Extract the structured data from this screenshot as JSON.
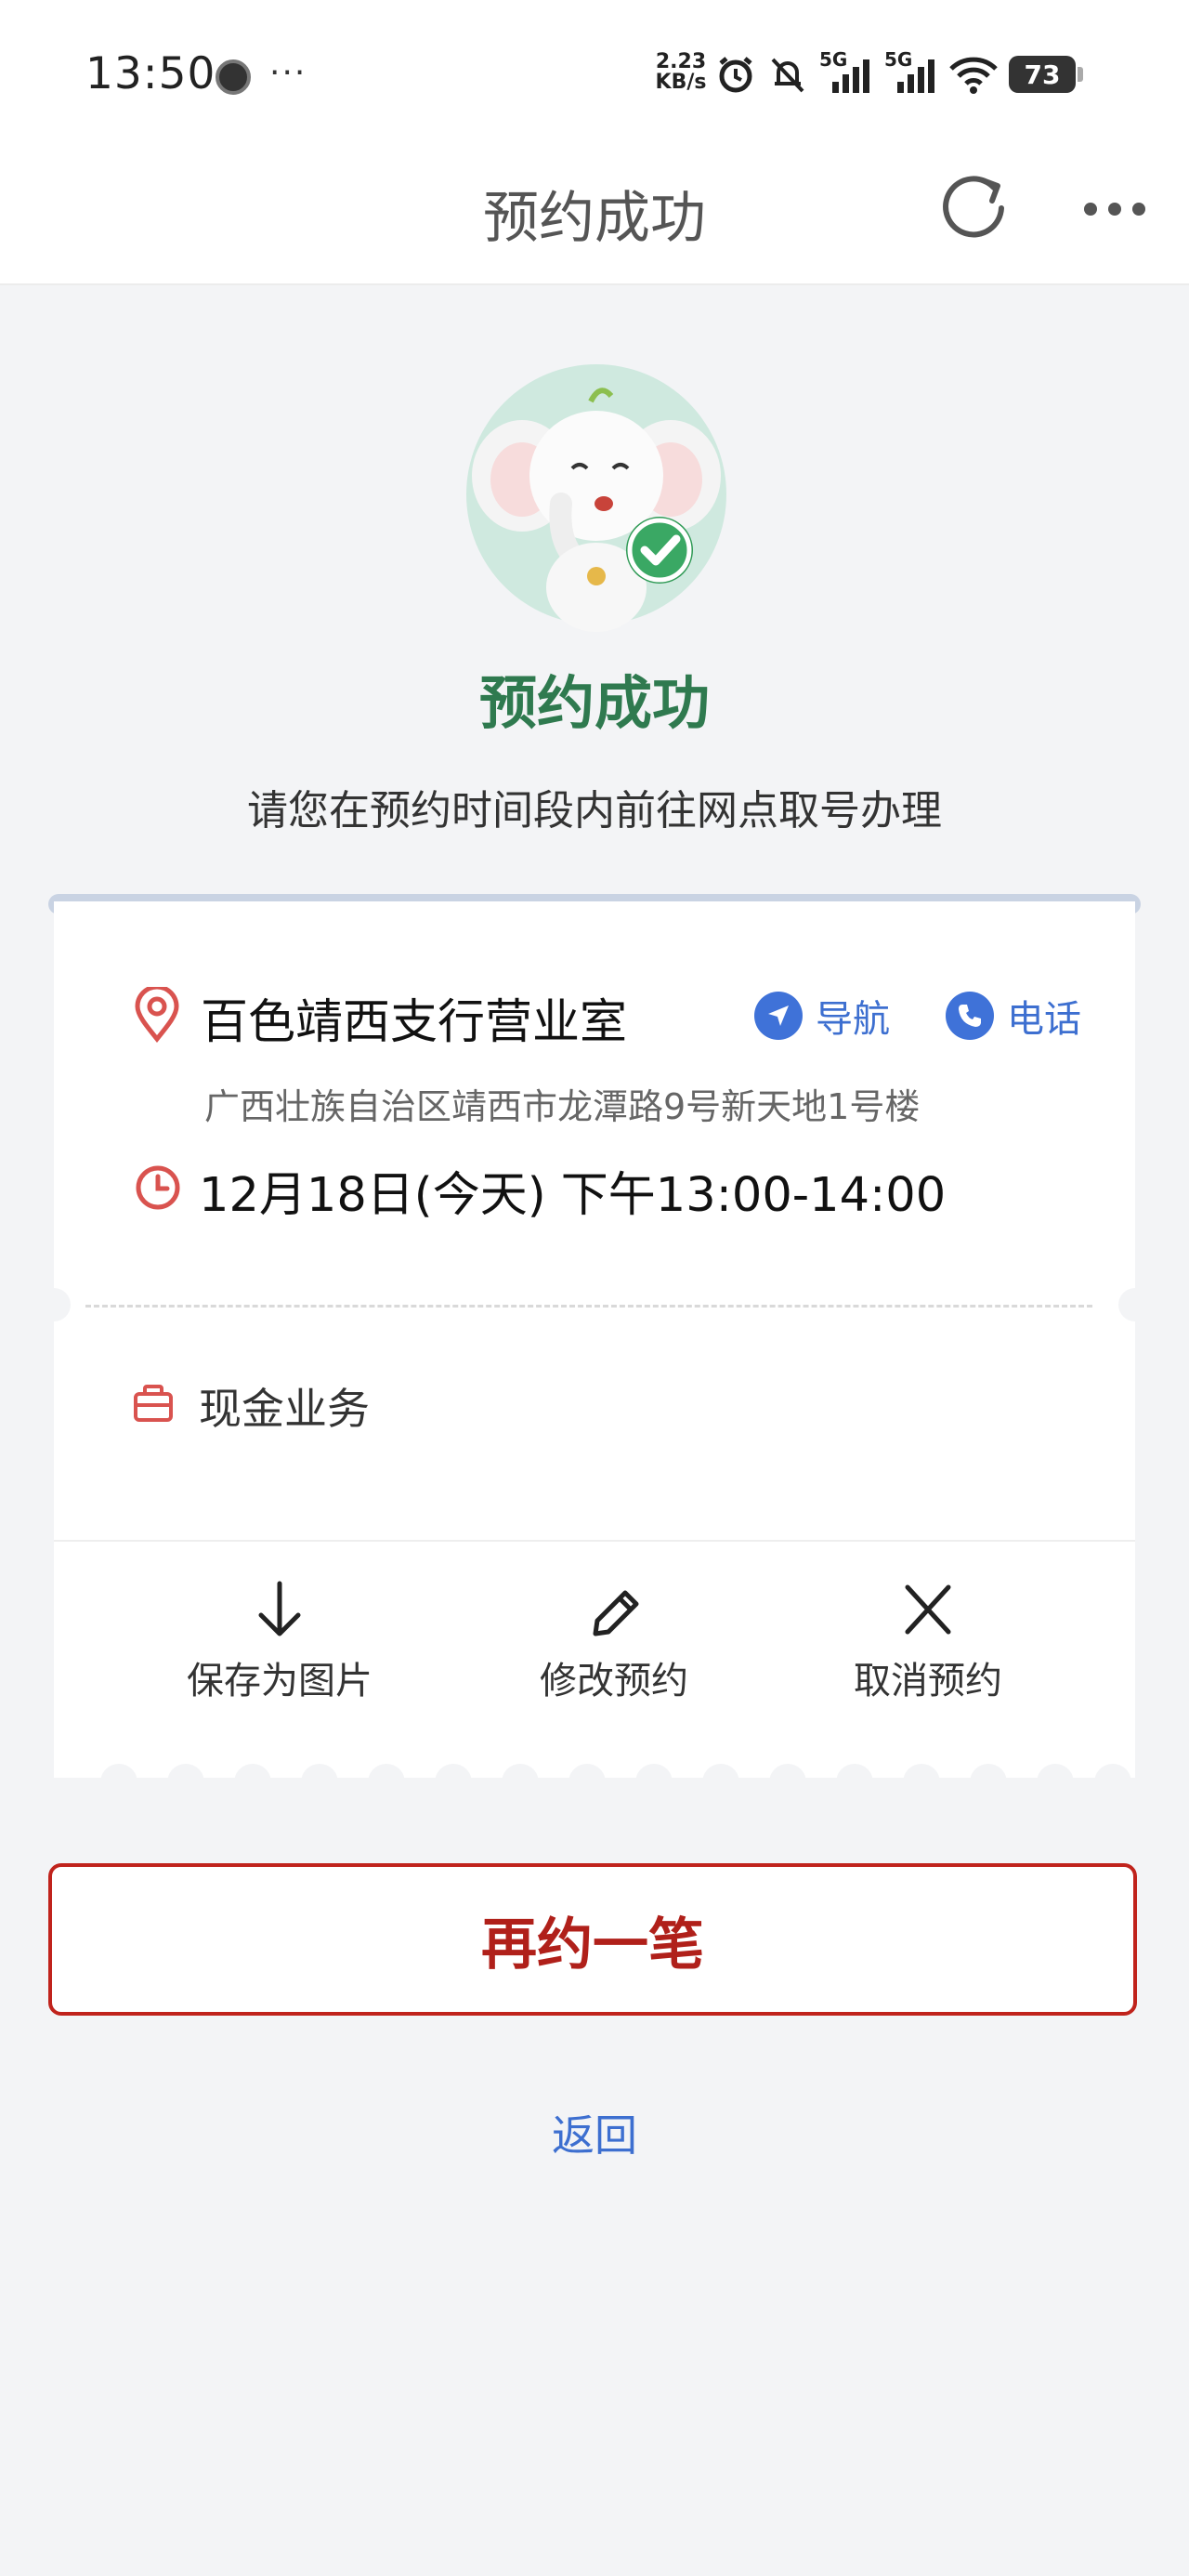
{
  "status_bar": {
    "time": "13:50",
    "more_dots": "···",
    "net_speed_value": "2.23",
    "net_speed_unit": "KB/s",
    "signal_1_label": "5G",
    "signal_2_label": "5G",
    "battery_level": "73"
  },
  "header": {
    "title": "预约成功",
    "refresh_icon": "refresh-icon",
    "more_icon": "more-icon"
  },
  "success": {
    "title": "预约成功",
    "subtitle": "请您在预约时间段内前往网点取号办理"
  },
  "ticket": {
    "branch_name": "百色靖西支行营业室",
    "navigate_label": "导航",
    "phone_label": "电话",
    "address": "广西壮族自治区靖西市龙潭路9号新天地1号楼",
    "time_range": "12月18日(今天) 下午13:00-14:00",
    "service": "现金业务",
    "actions": {
      "save_image": "保存为图片",
      "modify": "修改预约",
      "cancel": "取消预约"
    }
  },
  "buttons": {
    "book_again": "再约一笔",
    "back": "返回"
  },
  "colors": {
    "accent_green": "#2f7a4f",
    "accent_red": "#c0231c",
    "link_blue": "#3d6fd0",
    "icon_red": "#d9534f"
  }
}
